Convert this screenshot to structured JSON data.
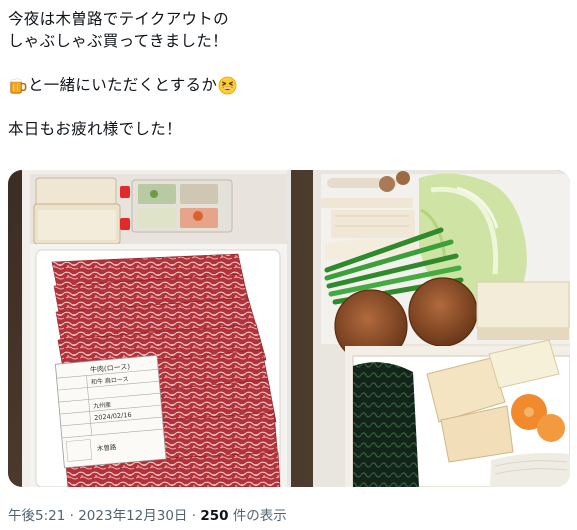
{
  "tweet": {
    "line1": "今夜は木曽路でテイクアウトの",
    "line2": "しゃぶしゃぶ買ってきました！",
    "line3": "と一緒にいただくとするか",
    "line4": "本日もお疲れ様でした！",
    "emoji_1": "beer-mug-icon",
    "emoji_2": "grinning-squinting-face-icon"
  },
  "meta": {
    "time": "午後5:21",
    "separator": "·",
    "date": "2023年12月30日",
    "view_count": "250",
    "view_label": "件の表示"
  },
  "label": {
    "row1": "牛肉(ロース)",
    "row2": "和牛 肩ロース",
    "row3": "九州産",
    "date": "2024/02/16",
    "maker": "木曽路"
  }
}
